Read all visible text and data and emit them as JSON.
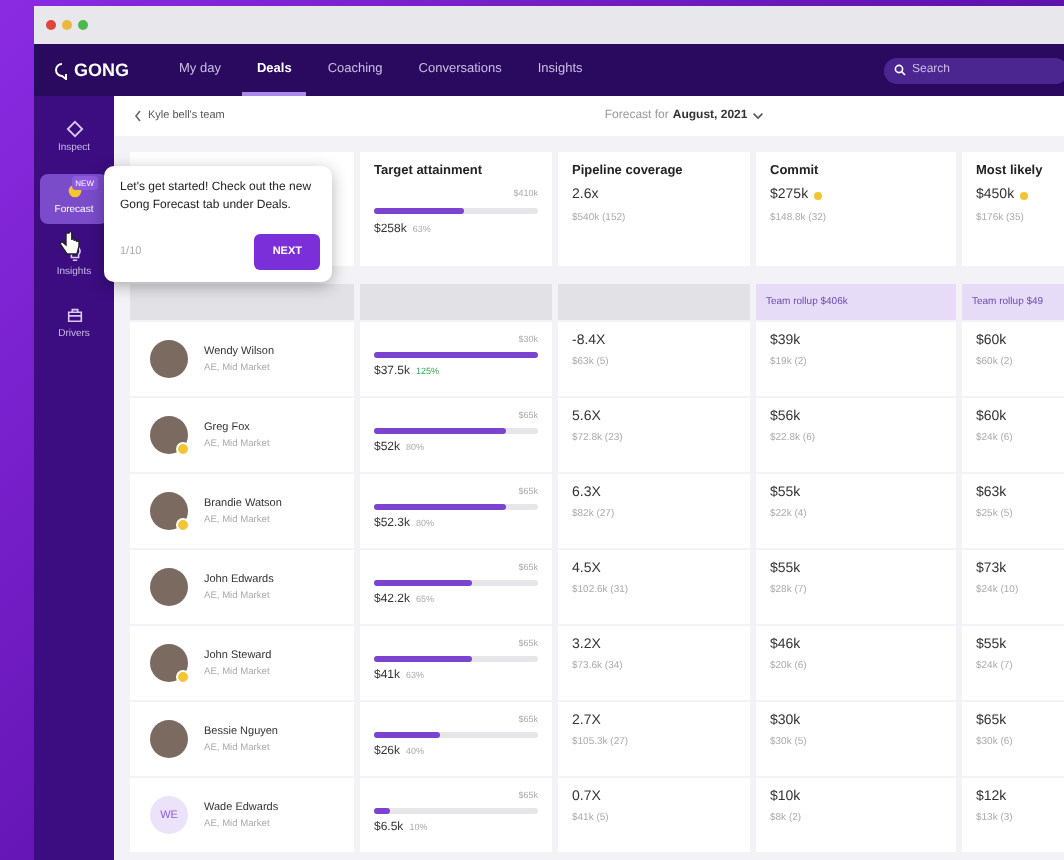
{
  "nav": {
    "logo": "GONG",
    "tabs": [
      {
        "label": "My day",
        "selected": false
      },
      {
        "label": "Deals",
        "selected": true
      },
      {
        "label": "Coaching",
        "selected": false
      },
      {
        "label": "Conversations",
        "selected": false
      },
      {
        "label": "Insights",
        "selected": false
      }
    ],
    "search": {
      "placeholder": "Search"
    }
  },
  "sidebar": {
    "items": [
      {
        "label": "Inspect",
        "kind": "diamond",
        "selected": false
      },
      {
        "label": "Forecast",
        "kind": "forecast",
        "selected": true,
        "badge": "NEW"
      },
      {
        "label": "Insights",
        "kind": "bulb",
        "selected": false
      },
      {
        "label": "Drivers",
        "kind": "box",
        "selected": false
      }
    ]
  },
  "breadcrumb": {
    "back": "Kyle bell's team",
    "forecast_label": "Forecast for",
    "period": "August, 2021"
  },
  "summary": [
    {
      "title": "Target attainment",
      "kind": "bar",
      "max": "$410k",
      "value": "$258k",
      "note": "63%",
      "level": 0.55
    },
    {
      "title": "Pipeline coverage",
      "kind": "text",
      "value": "2.6x",
      "note": "$540k (152)",
      "dot": false
    },
    {
      "title": "Commit",
      "kind": "text",
      "value": "$275k",
      "note": "$148.8k (32)",
      "dot": true
    },
    {
      "title": "Most likely",
      "kind": "text",
      "value": "$450k",
      "note": "$176k (35)",
      "dot": true
    }
  ],
  "rollups": [
    "Team rollup $406k",
    "Team rollup $49"
  ],
  "rows": [
    {
      "name": "Wendy Wilson",
      "role": "AE, Mid Market",
      "initials": "",
      "badge": false,
      "max": "$30k",
      "attainment": "$37.5k",
      "pct": "125%",
      "over": true,
      "level": 1,
      "coverage": "-8.4X",
      "pipeline": "$63k (5)",
      "commit": "$39k",
      "commit_note": "$19k (2)",
      "likely": "$60k",
      "likely_note": "$60k (2)"
    },
    {
      "name": "Greg Fox",
      "role": "AE, Mid Market",
      "initials": "",
      "badge": true,
      "max": "$65k",
      "attainment": "$52k",
      "pct": "80%",
      "over": false,
      "level": 0.8,
      "coverage": "5.6X",
      "pipeline": "$72.8k (23)",
      "commit": "$56k",
      "commit_note": "$22.8k (6)",
      "likely": "$60k",
      "likely_note": "$24k (6)"
    },
    {
      "name": "Brandie Watson",
      "role": "AE, Mid Market",
      "initials": "",
      "badge": true,
      "max": "$65k",
      "attainment": "$52.3k",
      "pct": "80%",
      "over": false,
      "level": 0.8,
      "coverage": "6.3X",
      "pipeline": "$82k (27)",
      "commit": "$55k",
      "commit_note": "$22k (4)",
      "likely": "$63k",
      "likely_note": "$25k (5)"
    },
    {
      "name": "John Edwards",
      "role": "AE, Mid Market",
      "initials": "",
      "badge": false,
      "max": "$65k",
      "attainment": "$42.2k",
      "pct": "65%",
      "over": false,
      "level": 0.6,
      "coverage": "4.5X",
      "pipeline": "$102.6k (31)",
      "commit": "$55k",
      "commit_note": "$28k (7)",
      "likely": "$73k",
      "likely_note": "$24k (10)"
    },
    {
      "name": "John Steward",
      "role": "AE, Mid Market",
      "initials": "",
      "badge": true,
      "max": "$65k",
      "attainment": "$41k",
      "pct": "63%",
      "over": false,
      "level": 0.6,
      "coverage": "3.2X",
      "pipeline": "$73.6k (34)",
      "commit": "$46k",
      "commit_note": "$20k (6)",
      "likely": "$55k",
      "likely_note": "$24k (7)"
    },
    {
      "name": "Bessie Nguyen",
      "role": "AE, Mid Market",
      "initials": "",
      "badge": false,
      "max": "$65k",
      "attainment": "$26k",
      "pct": "40%",
      "over": false,
      "level": 0.4,
      "coverage": "2.7X",
      "pipeline": "$105.3k (27)",
      "commit": "$30k",
      "commit_note": "$30k (5)",
      "likely": "$65k",
      "likely_note": "$30k (6)"
    },
    {
      "name": "Wade Edwards",
      "role": "AE, Mid Market",
      "initials": "WE",
      "badge": false,
      "max": "$65k",
      "attainment": "$6.5k",
      "pct": "10%",
      "over": false,
      "level": 0.1,
      "coverage": "0.7X",
      "pipeline": "$41k (5)",
      "commit": "$10k",
      "commit_note": "$8k (2)",
      "likely": "$12k",
      "likely_note": "$13k (3)"
    }
  ],
  "tooltip": {
    "text": "Let's get started! Check out the new Gong Forecast tab under Deals.",
    "step": "1/10",
    "button": "NEXT"
  }
}
